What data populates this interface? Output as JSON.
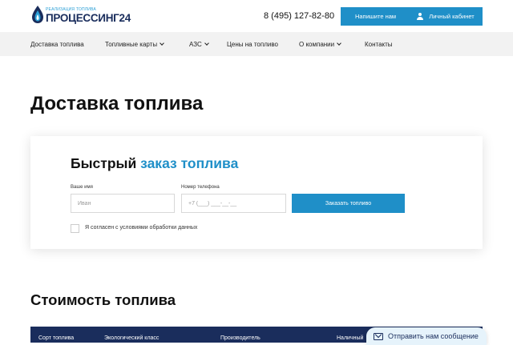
{
  "header": {
    "logo_tag": "Реализация топлива",
    "logo_text": "ПРОЦЕССИНГ24",
    "phone": "8 (495) 127-82-80",
    "write_button": "Напишите нам",
    "cabinet_button": "Личный кабинет"
  },
  "nav": {
    "items": [
      {
        "label": "Доставка топлива"
      },
      {
        "label": "Топливные карты"
      },
      {
        "label": "АЗС"
      },
      {
        "label": "Цены на топливо"
      },
      {
        "label": "О компании"
      },
      {
        "label": "Контакты"
      }
    ]
  },
  "page": {
    "title": "Доставка топлива"
  },
  "order_form": {
    "title_part1": "Быстрый",
    "title_part2": "заказ топлива",
    "name_label": "Ваше имя",
    "name_placeholder": "Иван",
    "phone_label": "Номер телефона",
    "phone_placeholder": "+7 (___) ___-__-__",
    "submit_label": "Заказать топливо",
    "consent_text": "Я согласен с условиями обработки данных"
  },
  "prices": {
    "title": "Стоимость топлива",
    "columns": [
      "Сорт топлива",
      "Экологический класс",
      "Производитель",
      "Наличный"
    ]
  },
  "chat": {
    "label": "Отправить нам сообщение"
  },
  "colors": {
    "accent": "#1f8fc8",
    "brand_dark": "#1a2d5c",
    "nav_bg": "#f2f2f2"
  }
}
